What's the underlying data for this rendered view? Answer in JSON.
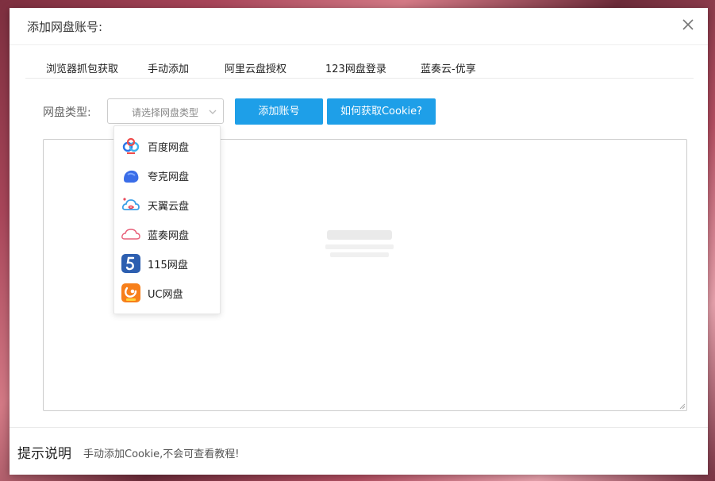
{
  "dialog": {
    "title": "添加网盘账号:"
  },
  "tabs": [
    {
      "label": "浏览器抓包获取"
    },
    {
      "label": "手动添加"
    },
    {
      "label": "阿里云盘授权"
    },
    {
      "label": "123网盘登录"
    },
    {
      "label": "蓝奏云-优享"
    }
  ],
  "form": {
    "type_label": "网盘类型:",
    "select_placeholder": "请选择网盘类型",
    "add_button": "添加账号",
    "how_button": "如何获取Cookie?"
  },
  "dropdown": {
    "items": [
      {
        "label": "百度网盘",
        "icon": "baidu-netdisk-icon"
      },
      {
        "label": "夸克网盘",
        "icon": "quark-netdisk-icon"
      },
      {
        "label": "天翼云盘",
        "icon": "tianyi-cloud-icon"
      },
      {
        "label": "蓝奏网盘",
        "icon": "lanzou-netdisk-icon"
      },
      {
        "label": "115网盘",
        "icon": "115-netdisk-icon"
      },
      {
        "label": "UC网盘",
        "icon": "uc-netdisk-icon"
      }
    ]
  },
  "tips": {
    "title": "提示说明",
    "text": "手动添加Cookie,不会可查看教程!"
  },
  "colors": {
    "accent": "#1e9fe8"
  }
}
